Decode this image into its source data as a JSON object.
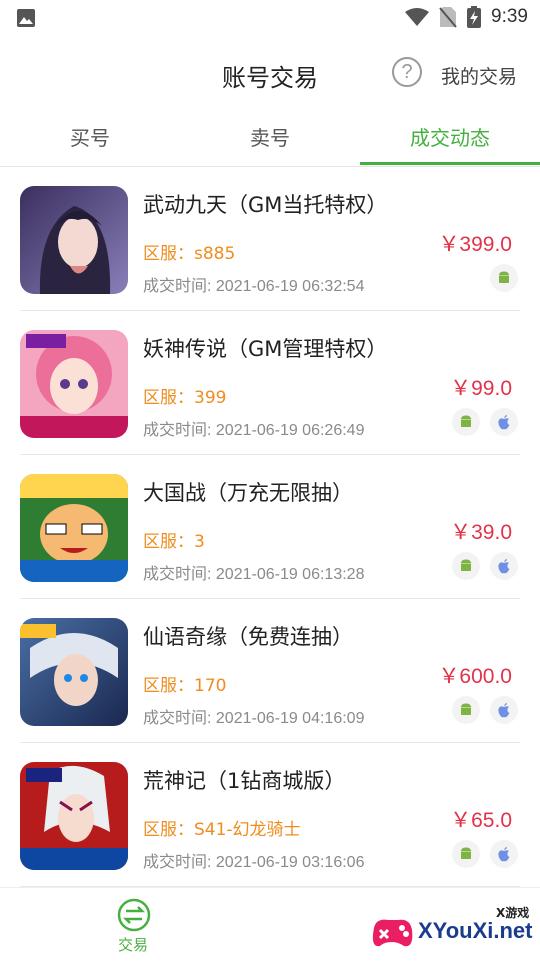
{
  "status_bar": {
    "time": "9:39"
  },
  "header": {
    "title": "账号交易",
    "my_trades": "我的交易"
  },
  "tabs": [
    {
      "label": "买号",
      "active": false
    },
    {
      "label": "卖号",
      "active": false
    },
    {
      "label": "成交动态",
      "active": true
    }
  ],
  "accent_color": "#45b03f",
  "price_color": "#e3334b",
  "server_color": "#f08c1e",
  "trades": [
    {
      "name": "武动九天（GM当托特权）",
      "server": "区服：s885",
      "time": "成交时间: 2021-06-19 06:32:54",
      "price": "￥399.0",
      "platforms": [
        "android"
      ]
    },
    {
      "name": "妖神传说（GM管理特权）",
      "server": "区服：399",
      "time": "成交时间: 2021-06-19 06:26:49",
      "price": "￥99.0",
      "platforms": [
        "android",
        "ios"
      ]
    },
    {
      "name": "大国战（万充无限抽）",
      "server": "区服：3",
      "time": "成交时间: 2021-06-19 06:13:28",
      "price": "￥39.0",
      "platforms": [
        "android",
        "ios"
      ]
    },
    {
      "name": "仙语奇缘（免费连抽）",
      "server": "区服：170",
      "time": "成交时间: 2021-06-19 04:16:09",
      "price": "￥600.0",
      "platforms": [
        "android",
        "ios"
      ]
    },
    {
      "name": "荒神记（1钻商城版）",
      "server": "区服：S41-幻龙骑士",
      "time": "成交时间: 2021-06-19 03:16:06",
      "price": "￥65.0",
      "platforms": [
        "android",
        "ios"
      ]
    }
  ],
  "bottom_nav": {
    "label": "交易"
  },
  "watermark": {
    "small": "X游戏",
    "big": "XYouXi.net"
  }
}
